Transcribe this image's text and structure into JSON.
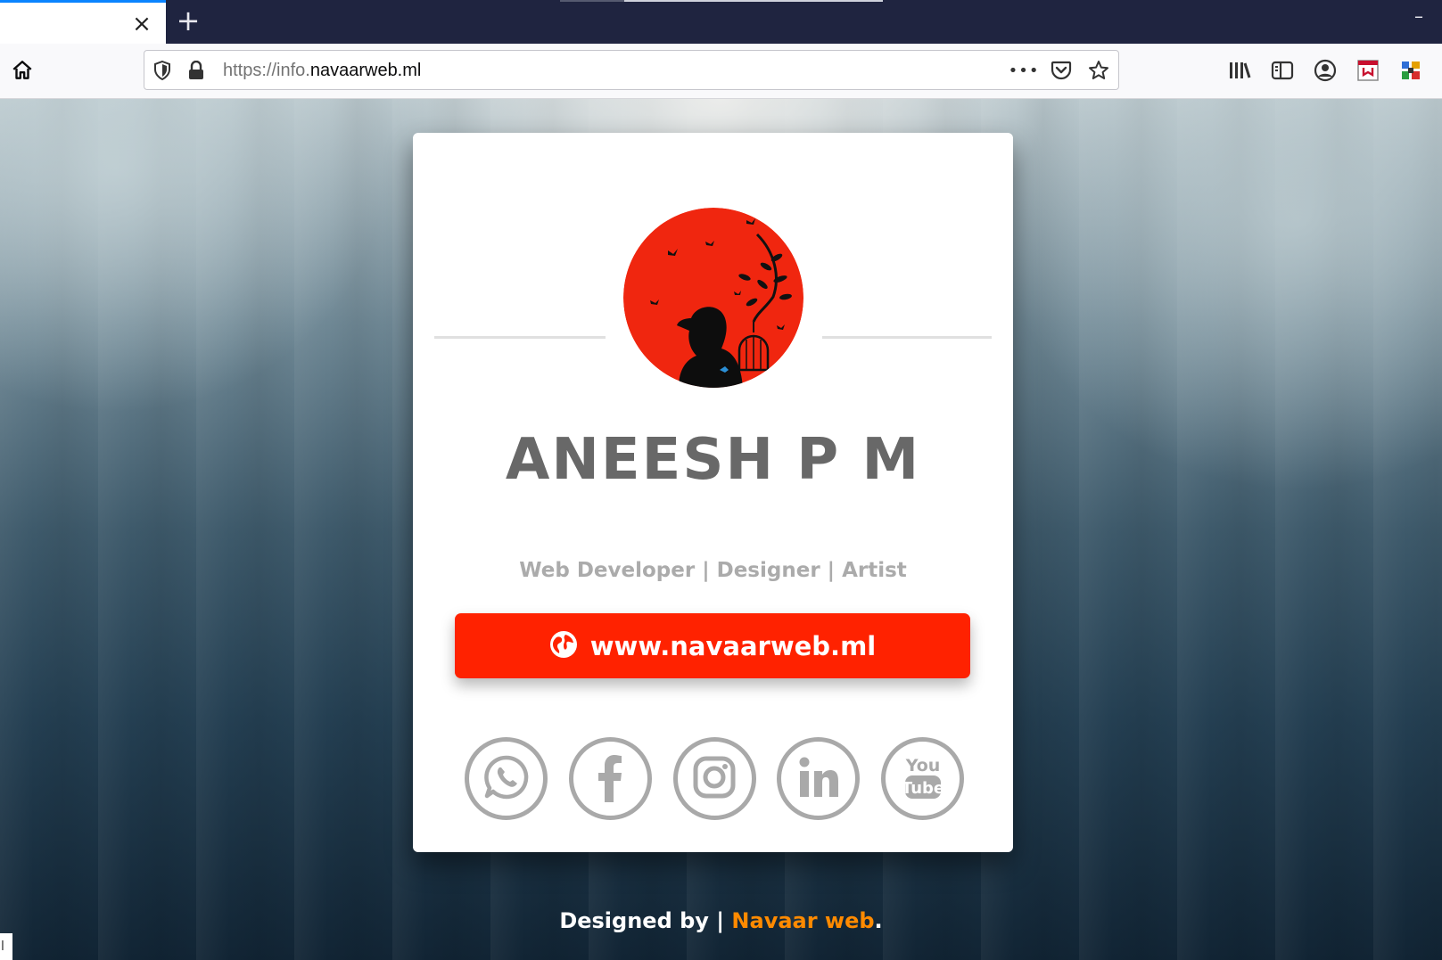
{
  "browser": {
    "tab": {
      "close_glyph": "×",
      "new_tab_glyph": "+"
    },
    "window": {
      "minimize_glyph": "–"
    },
    "url": {
      "scheme": "https://info.",
      "host": "navaarweb.ml",
      "more_glyph": "•••"
    },
    "icons": {
      "home": "home-icon",
      "tracking": "shield-icon",
      "lock": "lock-icon",
      "pocket": "pocket-icon",
      "bookmark": "star-icon",
      "library": "library-icon",
      "sidebar": "sidebar-icon",
      "account": "account-icon",
      "extension_1": "extension-icon",
      "extension_2": "extension-icon"
    }
  },
  "profile": {
    "name": "ANEESH P M",
    "subtitle": "Web Developer | Designer | Artist",
    "website_label": "www.navaarweb.ml",
    "accent": "#ff2200",
    "socials": [
      {
        "name": "whatsapp",
        "icon": "whatsapp-icon"
      },
      {
        "name": "facebook",
        "icon": "facebook-icon"
      },
      {
        "name": "instagram",
        "icon": "instagram-icon"
      },
      {
        "name": "linkedin",
        "icon": "linkedin-icon"
      },
      {
        "name": "youtube",
        "icon": "youtube-icon"
      }
    ],
    "social_color": "#a9a9a9"
  },
  "footer": {
    "prefix": "Designed by | ",
    "brand": "Navaar web",
    "suffix": ".",
    "brand_color": "#ff8a00"
  }
}
